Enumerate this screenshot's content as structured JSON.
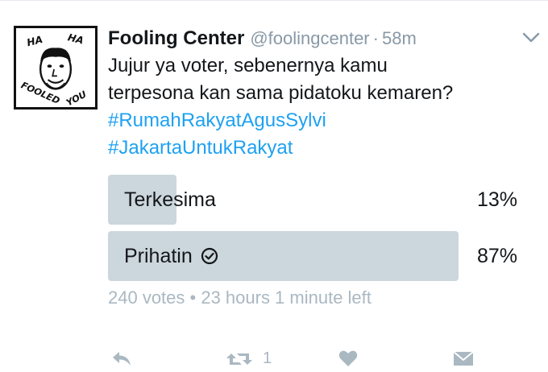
{
  "tweet": {
    "author_name": "Fooling Center",
    "handle": "@foolingcenter",
    "separator": "·",
    "time": "58m",
    "text_lines": [
      "Jujur ya voter, sebenernya kamu",
      "terpesona kan sama pidatoku kemaren?"
    ],
    "hashtags": [
      "#RumahRakyatAgusSylvi",
      "#JakartaUntukRakyat"
    ],
    "avatar_text_top": "HA HA",
    "avatar_text_bottom": "FOOLED YOU"
  },
  "poll": {
    "options": [
      {
        "label": "Terkesima",
        "percent_text": "13%",
        "fraction": 0.13,
        "selected": false
      },
      {
        "label": "Prihatin",
        "percent_text": "87%",
        "fraction": 0.87,
        "selected": true
      }
    ],
    "meta": "240 votes • 23 hours 1 minute left"
  },
  "actions": {
    "retweet_count": "1"
  },
  "colors": {
    "text": "#14171a",
    "secondary": "#8899a6",
    "hashtag": "#1da1f2",
    "poll_bar": "#ccd6dd",
    "icon": "#aab8c2"
  },
  "icons": {
    "menu": "chevron-down-icon",
    "reply": "reply-icon",
    "retweet": "retweet-icon",
    "like": "heart-icon",
    "message": "envelope-icon",
    "vote": "check-circle-icon"
  }
}
